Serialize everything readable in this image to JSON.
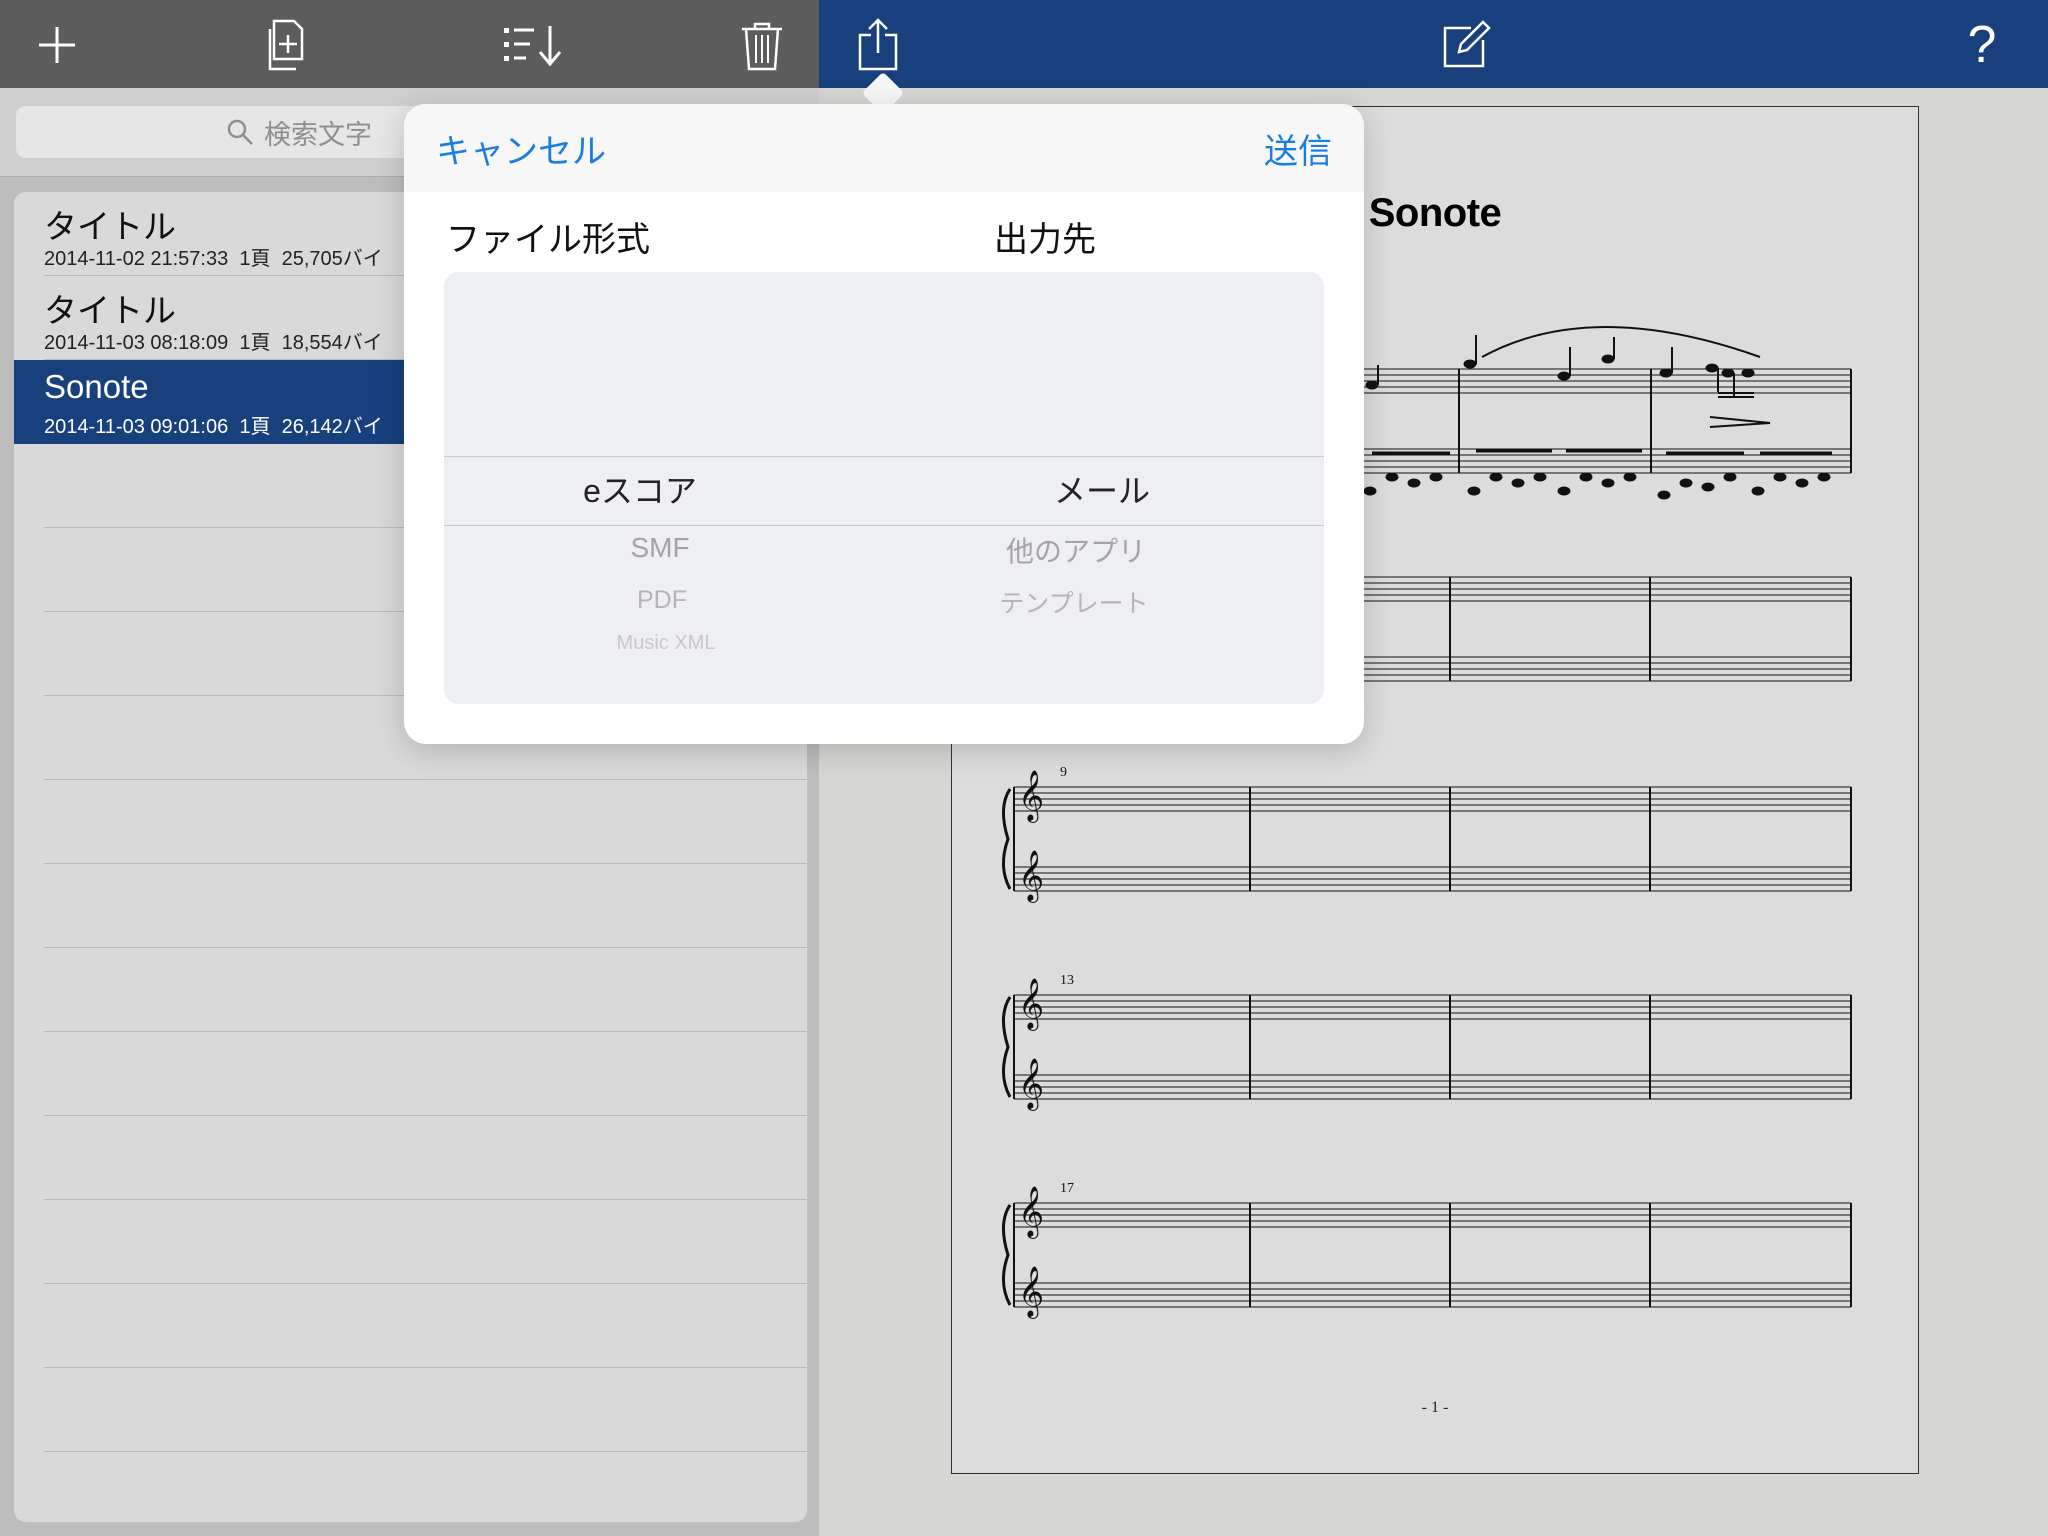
{
  "left_toolbar": {
    "icons": [
      "plus-icon",
      "copy-document-icon",
      "sort-list-icon",
      "trash-icon"
    ]
  },
  "search": {
    "placeholder": "検索文字"
  },
  "file_list": [
    {
      "title": "タイトル",
      "meta": "2014-11-02 21:57:33  1頁  25,705バイ",
      "selected": false
    },
    {
      "title": "タイトル",
      "meta": "2014-11-03 08:18:09  1頁  18,554バイ",
      "selected": false
    },
    {
      "title": "Sonote",
      "meta": "2014-11-03 09:01:06  1頁  26,142バイ",
      "selected": true
    }
  ],
  "right_toolbar": {
    "icons": [
      "share-icon",
      "edit-icon",
      "help-icon"
    ],
    "help_label": "?"
  },
  "score": {
    "title": "Sonote",
    "measure_numbers": [
      "9",
      "13",
      "17"
    ],
    "page_number": "- 1 -"
  },
  "export_popover": {
    "cancel_label": "キャンセル",
    "send_label": "送信",
    "format_header": "ファイル形式",
    "destination_header": "出力先",
    "formats": [
      "eスコア",
      "SMF",
      "PDF",
      "Music XML"
    ],
    "selected_format": "eスコア",
    "destinations": [
      "メール",
      "他のアプリ",
      "テンプレート"
    ],
    "selected_destination": "メール"
  },
  "colors": {
    "left_toolbar": "#5c5c5c",
    "right_toolbar": "#17407d",
    "selection": "#17407d",
    "accent_blue": "#1a7ee0"
  }
}
